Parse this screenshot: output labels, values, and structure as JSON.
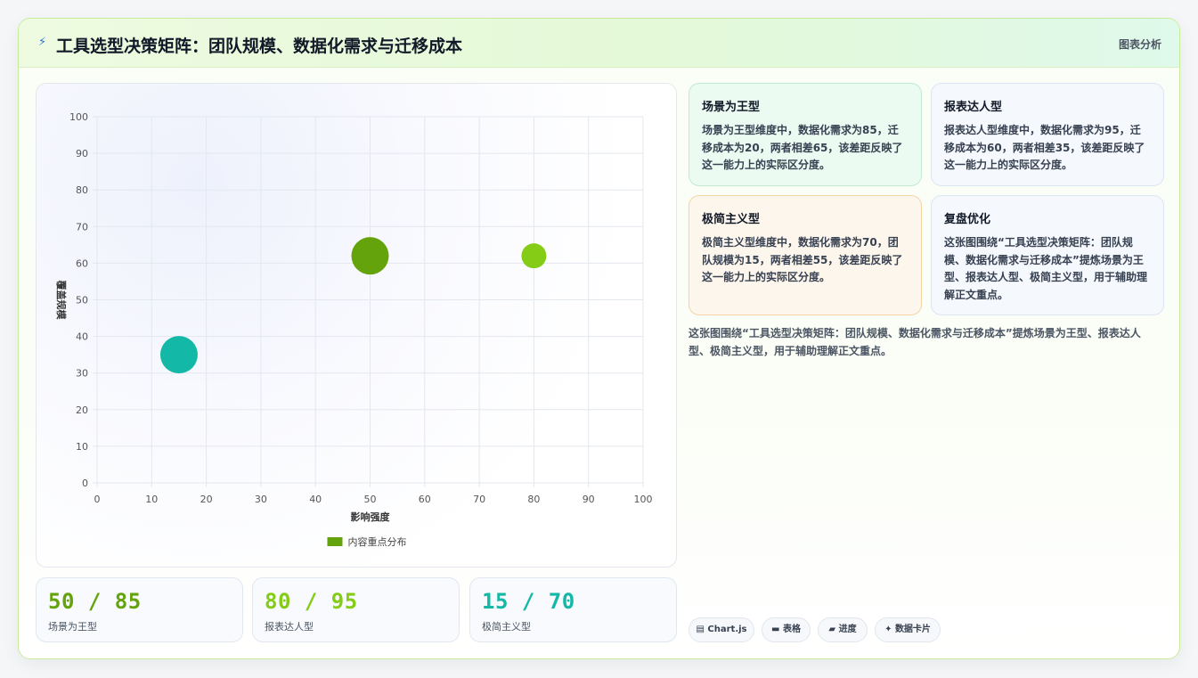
{
  "header": {
    "icon": "lightning-icon",
    "title": "工具选型决策矩阵：团队规模、数据化需求与迁移成本",
    "tag": "图表分析"
  },
  "chart_data": {
    "type": "scatter",
    "xlabel": "影响强度",
    "ylabel": "覆盖规模",
    "xlim": [
      0,
      100
    ],
    "ylim": [
      0,
      100
    ],
    "x_ticks": [
      0,
      10,
      20,
      30,
      40,
      50,
      60,
      70,
      80,
      90,
      100
    ],
    "y_ticks": [
      0,
      10,
      20,
      30,
      40,
      50,
      60,
      70,
      80,
      90,
      100
    ],
    "grid": true,
    "legend_position": "bottom",
    "legend": "内容重点分布",
    "legend_color": "#65a30d",
    "points": [
      {
        "x": 15,
        "y": 35,
        "r": 21,
        "color": "#14b8a6"
      },
      {
        "x": 50,
        "y": 62,
        "r": 21,
        "color": "#65a30d"
      },
      {
        "x": 80,
        "y": 62,
        "r": 14,
        "color": "#84cc16"
      }
    ]
  },
  "stats": [
    {
      "value": "50 / 85",
      "label": "场景为王型",
      "color": "#65a30d"
    },
    {
      "value": "80 / 95",
      "label": "报表达人型",
      "color": "#84cc16"
    },
    {
      "value": "15 / 70",
      "label": "极简主义型",
      "color": "#14b8a6"
    }
  ],
  "cards": [
    {
      "title": "场景为王型",
      "body": "场景为王型维度中，数据化需求为85，迁移成本为20，两者相差65，该差距反映了这一能力上的实际区分度。"
    },
    {
      "title": "报表达人型",
      "body": "报表达人型维度中，数据化需求为95，迁移成本为60，两者相差35，该差距反映了这一能力上的实际区分度。"
    },
    {
      "title": "极简主义型",
      "body": "极简主义型维度中，数据化需求为70，团队规模为15，两者相差55，该差距反映了这一能力上的实际区分度。"
    },
    {
      "title": "复盘优化",
      "body": "这张图围绕“工具选型决策矩阵：团队规模、数据化需求与迁移成本”提炼场景为王型、报表达人型、极简主义型，用于辅助理解正文重点。"
    }
  ],
  "summary": "这张图围绕“工具选型决策矩阵：团队规模、数据化需求与迁移成本”提炼场景为王型、报表达人型、极简主义型，用于辅助理解正文重点。",
  "chips": [
    {
      "icon": "chart-icon",
      "glyph": "▤",
      "label": "Chart.js"
    },
    {
      "icon": "table-icon",
      "glyph": "▬",
      "label": "表格"
    },
    {
      "icon": "progress-icon",
      "glyph": "▰",
      "label": "进度"
    },
    {
      "icon": "sparkle-icon",
      "glyph": "✦",
      "label": "数据卡片"
    }
  ]
}
